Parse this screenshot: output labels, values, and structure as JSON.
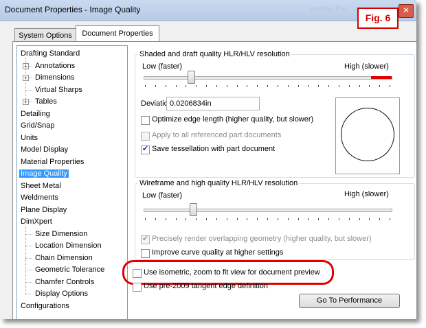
{
  "window": {
    "title": "Document Properties - Image Quality",
    "title_ghost": "Untitled Part",
    "close_glyph": "✕"
  },
  "figure_label": "Fig. 6",
  "tabs": [
    {
      "label": "System Options",
      "active": false
    },
    {
      "label": "Document Properties",
      "active": true
    }
  ],
  "tree": {
    "items": [
      {
        "label": "Drafting Standard",
        "level": 0
      },
      {
        "label": "Annotations",
        "level": 1,
        "expander": "+"
      },
      {
        "label": "Dimensions",
        "level": 1,
        "expander": "+"
      },
      {
        "label": "Virtual Sharps",
        "level": 1
      },
      {
        "label": "Tables",
        "level": 1,
        "expander": "+"
      },
      {
        "label": "Detailing",
        "level": 0
      },
      {
        "label": "Grid/Snap",
        "level": 0
      },
      {
        "label": "Units",
        "level": 0
      },
      {
        "label": "Model Display",
        "level": 0
      },
      {
        "label": "Material Properties",
        "level": 0
      },
      {
        "label": "Image Quality",
        "level": 0,
        "selected": true
      },
      {
        "label": "Sheet Metal",
        "level": 0
      },
      {
        "label": "Weldments",
        "level": 0
      },
      {
        "label": "Plane Display",
        "level": 0
      },
      {
        "label": "DimXpert",
        "level": 0
      },
      {
        "label": "Size Dimension",
        "level": 1
      },
      {
        "label": "Location Dimension",
        "level": 1
      },
      {
        "label": "Chain Dimension",
        "level": 1
      },
      {
        "label": "Geometric Tolerance",
        "level": 1
      },
      {
        "label": "Chamfer Controls",
        "level": 1
      },
      {
        "label": "Display Options",
        "level": 1
      },
      {
        "label": "Configurations",
        "level": 0
      }
    ]
  },
  "shaded": {
    "group_title": "Shaded and draft quality HLR/HLV resolution",
    "low_label": "Low (faster)",
    "high_label": "High (slower)",
    "slider_value_fraction": 0.2,
    "deviation_label": "Deviation:",
    "deviation_value": "0.0206834in",
    "optimize_label": "Optimize edge length (higher quality, but slower)",
    "optimize_checked": false,
    "apply_all_label": "Apply to all referenced part documents",
    "apply_all_checked": false,
    "apply_all_enabled": false,
    "save_tess_label": "Save tessellation with part document",
    "save_tess_checked": true
  },
  "wireframe": {
    "group_title": "Wireframe and high quality HLR/HLV resolution",
    "low_label": "Low (faster)",
    "high_label": "High (slower)",
    "slider_value_fraction": 0.2,
    "precise_label": "Precisely render overlapping geometry (higher quality, but slower)",
    "precise_checked": true,
    "precise_enabled": false,
    "curve_label": "Improve curve quality at higher settings",
    "curve_checked": false
  },
  "isometric_label": "Use isometric, zoom to fit view for document preview",
  "isometric_checked": false,
  "pre2009_label": "Use pre-2009 tangent edge definition",
  "pre2009_checked": false,
  "performance_button": "Go To Performance",
  "colors": {
    "selection": "#3399ff",
    "callout": "#e00000",
    "title_bar": "#c9daf0"
  }
}
